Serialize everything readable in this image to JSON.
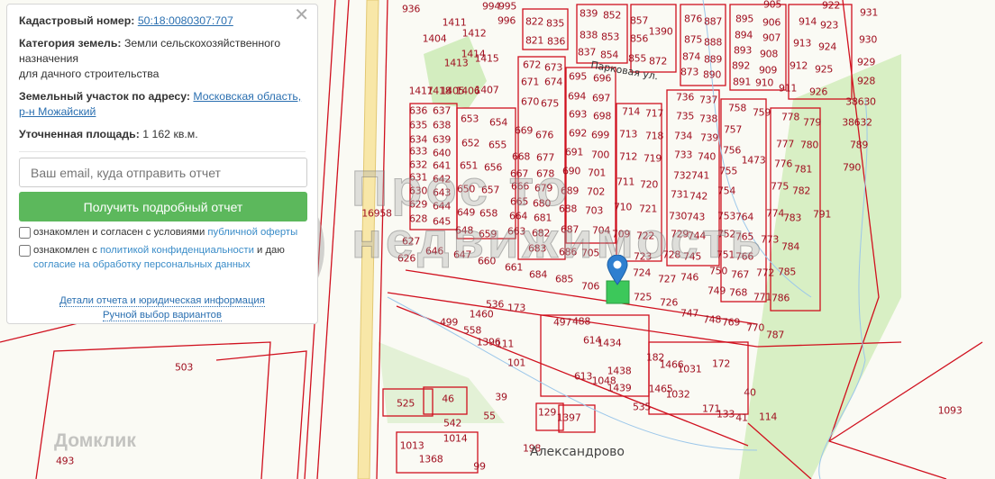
{
  "info_panel": {
    "cadastral_label": "Кадастровый номер:",
    "cadastral_number": "50:18:0080307:707",
    "category_label": "Категория земель:",
    "category_value_1": "Земли сельскохозяйственного назначения",
    "category_value_2": "для дачного строительства",
    "address_label": "Земельный участок по адресу:",
    "address_value": "Московская область, р-н Можайский",
    "area_label": "Уточненная площадь:",
    "area_value": "1 162 кв.м.",
    "email_placeholder": "Ваш email, куда отправить отчет",
    "submit_label": "Получить подробный отчет",
    "consent1_text": "ознакомлен и согласен с условиями",
    "consent1_link": "публичной оферты",
    "consent2_text": "ознакомлен с",
    "consent2_link": "политикой конфиденциальности",
    "consent2_mid": "и даю",
    "consent2_link2": "согласие на обработку персональных данных",
    "details_link": "Детали отчета и юридическая информация",
    "manual_link": "Ручной выбор вариантов",
    "close_icon": "close-icon"
  },
  "map": {
    "village": "Александрово",
    "street_parkovaya": "Парковая ул.",
    "watermark_logo_text": "Просто недвижимость",
    "domclick_watermark": "Домклик",
    "selected_color": "#3cc85a",
    "parcel_color": "#d0101e",
    "parcels": [
      "636",
      "637",
      "635",
      "638",
      "634",
      "639",
      "633",
      "640",
      "632",
      "641",
      "631",
      "642",
      "630",
      "643",
      "629",
      "644",
      "628",
      "645",
      "653",
      "654",
      "652",
      "655",
      "651",
      "656",
      "650",
      "657",
      "649",
      "658",
      "648",
      "659",
      "672",
      "673",
      "671",
      "674",
      "670",
      "675",
      "669",
      "676",
      "668",
      "677",
      "667",
      "678",
      "666",
      "679",
      "665",
      "680",
      "664",
      "681",
      "663",
      "682",
      "683",
      "695",
      "696",
      "694",
      "697",
      "693",
      "698",
      "692",
      "699",
      "691",
      "700",
      "690",
      "701",
      "689",
      "702",
      "688",
      "703",
      "687",
      "704",
      "705",
      "686",
      "714",
      "717",
      "713",
      "718",
      "712",
      "719",
      "711",
      "720",
      "710",
      "721",
      "709",
      "722",
      "723",
      "724",
      "725",
      "736",
      "737",
      "735",
      "738",
      "734",
      "739",
      "733",
      "740",
      "732",
      "741",
      "731",
      "742",
      "730",
      "743",
      "729",
      "744",
      "728",
      "745",
      "727",
      "746",
      "726",
      "758",
      "759",
      "757",
      "756",
      "755",
      "754",
      "753",
      "752",
      "751",
      "750",
      "749",
      "764",
      "765",
      "766",
      "767",
      "768",
      "1473",
      "778",
      "779",
      "777",
      "780",
      "776",
      "781",
      "775",
      "782",
      "774",
      "783",
      "773",
      "784",
      "772",
      "785",
      "771",
      "786",
      "791",
      "994",
      "995",
      "996",
      "822",
      "835",
      "821",
      "836",
      "839",
      "852",
      "838",
      "853",
      "837",
      "854",
      "857",
      "856",
      "855",
      "872",
      "1390",
      "876",
      "887",
      "875",
      "888",
      "874",
      "889",
      "873",
      "890",
      "895",
      "906",
      "894",
      "907",
      "893",
      "908",
      "892",
      "909",
      "891",
      "910",
      "905",
      "922",
      "914",
      "923",
      "913",
      "924",
      "912",
      "925",
      "911",
      "926",
      "931",
      "930",
      "929",
      "928",
      "38630",
      "38632",
      "789",
      "790",
      "1411",
      "1412",
      "1404",
      "1413",
      "1414",
      "1415",
      "1417",
      "1418",
      "1405",
      "1406",
      "1407",
      "936",
      "16958",
      "627",
      "626",
      "646",
      "647",
      "660",
      "661",
      "684",
      "685",
      "706",
      "1460",
      "499",
      "558",
      "536",
      "173",
      "1396",
      "111",
      "101",
      "497",
      "488",
      "614",
      "1434",
      "613",
      "1048",
      "1438",
      "1439",
      "535",
      "182",
      "1466",
      "1031",
      "1465",
      "1032",
      "172",
      "171",
      "133",
      "40",
      "41",
      "114",
      "748",
      "769",
      "770",
      "787",
      "747",
      "129",
      "1397",
      "525",
      "46",
      "39",
      "55",
      "542",
      "1014",
      "1013",
      "1368",
      "99",
      "198",
      "503",
      "493",
      "1093"
    ]
  }
}
